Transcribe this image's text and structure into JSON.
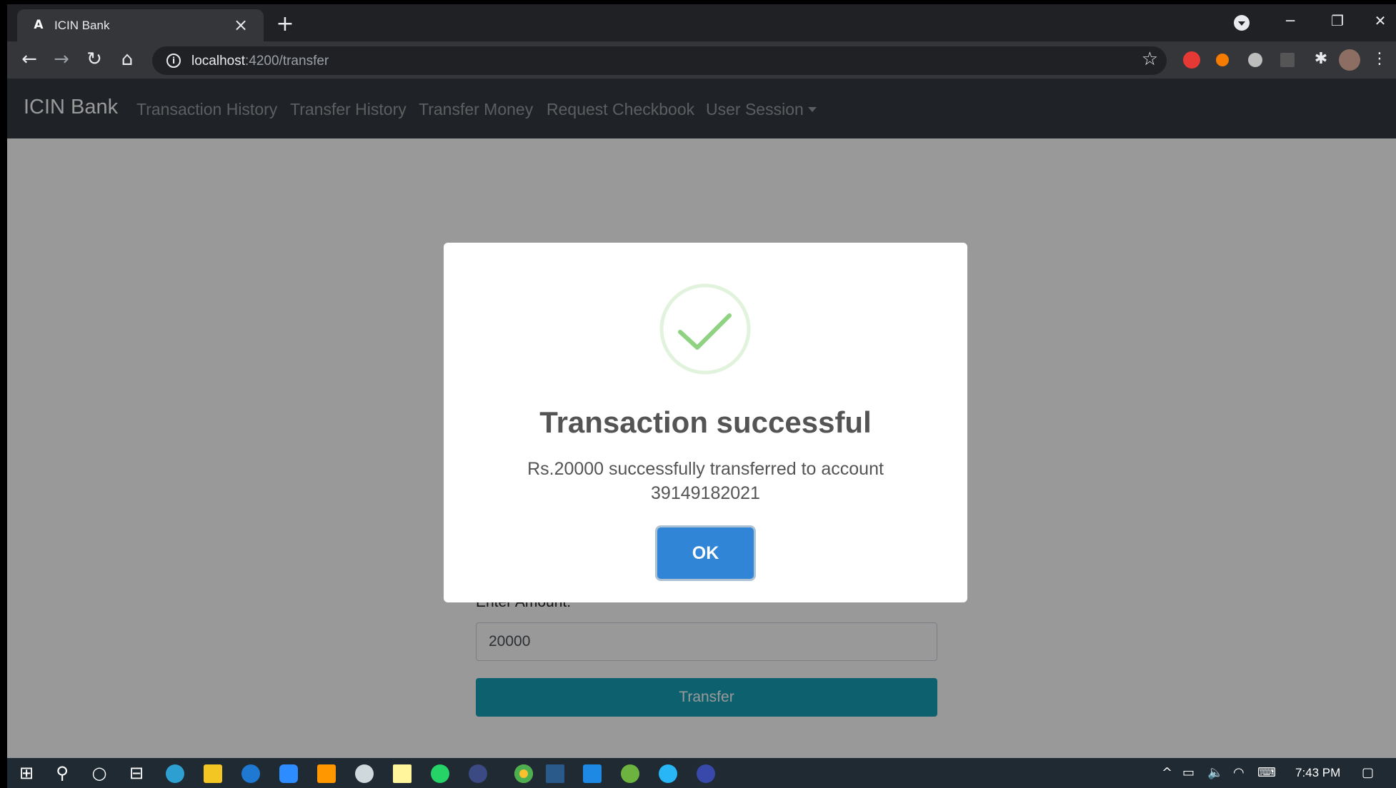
{
  "browser": {
    "tab_title": "ICIN Bank",
    "tab_favicon": "A",
    "url_host": "localhost",
    "url_rest": ":4200/transfer"
  },
  "navbar": {
    "brand": "ICIN Bank",
    "links": [
      "Transaction History",
      "Transfer History",
      "Transfer Money",
      "Request Checkbook",
      "User Session"
    ]
  },
  "form": {
    "amount_label": "Enter Amount:",
    "amount_value": "20000",
    "submit_label": "Transfer"
  },
  "modal": {
    "title": "Transaction successful",
    "message": "Rs.20000 successfully transferred to account 39149182021",
    "ok_label": "OK",
    "icon": "success-check-icon"
  },
  "taskbar": {
    "time": "7:43 PM"
  },
  "colors": {
    "navbar": "#343a40",
    "transfer_button": "#17a2b8",
    "ok_button": "#3085d6",
    "success_green": "#8fd282"
  }
}
